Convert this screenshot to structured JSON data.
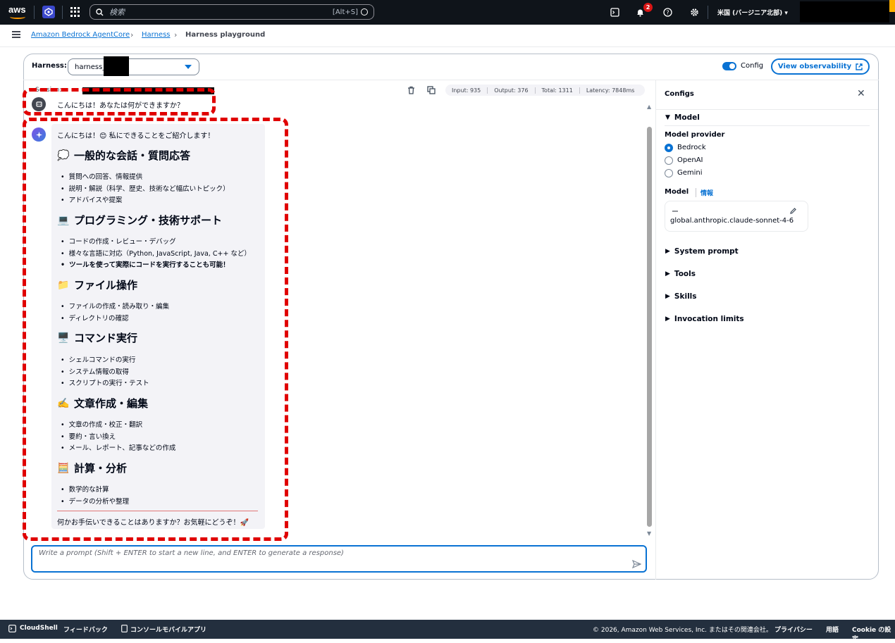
{
  "topnav": {
    "logo_text": "aws",
    "search_placeholder": "検索",
    "search_shortcut": "[Alt+S]",
    "notification_count": "2",
    "region": "米国 (バージニア北部) ▾"
  },
  "breadcrumb": {
    "items": [
      "Amazon Bedrock AgentCore",
      "Harness",
      "Harness playground"
    ]
  },
  "harness": {
    "label": "Harness:",
    "value": "harness_",
    "config_label": "Config",
    "observability_button": "View observability"
  },
  "chat": {
    "session_label": "Session:",
    "metrics": [
      "Input: 935",
      "Output: 376",
      "Total: 1311",
      "Latency: 7848ms"
    ],
    "user_message": "こんにちは！あなたは何ができますか？",
    "ai_intro": "こんにちは！😊 私にできることをご紹介します！",
    "sections": [
      {
        "emoji": "💭",
        "title": "一般的な会話・質問応答",
        "items": [
          "質問への回答、情報提供",
          "説明・解説（科学、歴史、技術など幅広いトピック）",
          "アドバイスや提案"
        ]
      },
      {
        "emoji": "💻",
        "title": "プログラミング・技術サポート",
        "items": [
          "コードの作成・レビュー・デバッグ",
          "様々な言語に対応（Python, JavaScript, Java, C++ など）",
          "ツールを使って実際にコードを実行することも可能！"
        ]
      },
      {
        "emoji": "📁",
        "title": "ファイル操作",
        "items": [
          "ファイルの作成・読み取り・編集",
          "ディレクトリの確認"
        ]
      },
      {
        "emoji": "🖥️",
        "title": "コマンド実行",
        "items": [
          "シェルコマンドの実行",
          "システム情報の取得",
          "スクリプトの実行・テスト"
        ]
      },
      {
        "emoji": "✍️",
        "title": "文章作成・編集",
        "items": [
          "文章の作成・校正・翻訳",
          "要約・言い換え",
          "メール、レポート、記事などの作成"
        ]
      },
      {
        "emoji": "🧮",
        "title": "計算・分析",
        "items": [
          "数学的な計算",
          "データの分析や整理"
        ]
      }
    ],
    "ai_outro": "何かお手伝いできることはありますか？お気軽にどうぞ！🚀",
    "prompt_placeholder": "Write a prompt (Shift + ENTER to start a new line, and ENTER to generate a response)"
  },
  "configs": {
    "title": "Configs",
    "model_section": "Model",
    "model_provider_label": "Model provider",
    "providers": [
      "Bedrock",
      "OpenAI",
      "Gemini"
    ],
    "selected_provider": "Bedrock",
    "model_label": "Model",
    "info_link": "情報",
    "model_value": "global.anthropic.claude-sonnet-4-6",
    "model_prefix": "ー",
    "sections": [
      "System prompt",
      "Tools",
      "Skills",
      "Invocation limits"
    ]
  },
  "footer": {
    "cloudshell": "CloudShell",
    "feedback": "フィードバック",
    "mobile_app": "コンソールモバイルアプリ",
    "copyright": "© 2026, Amazon Web Services, Inc. またはその関連会社。",
    "privacy": "プライバシー",
    "terms": "用語",
    "cookie": "Cookie の設定"
  },
  "colors": {
    "accent": "#0972d3",
    "nav_bg": "#0f141a",
    "highlight": "#e00000"
  }
}
